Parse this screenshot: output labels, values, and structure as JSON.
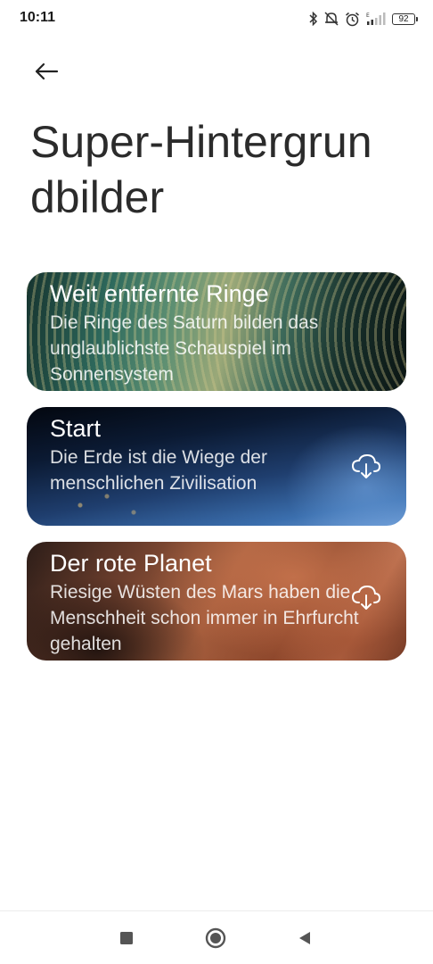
{
  "status_bar": {
    "time": "10:11",
    "battery_level": "92",
    "icons": [
      "bluetooth-icon",
      "alarm-off-icon",
      "alarm-clock-icon",
      "signal-icon",
      "battery-icon"
    ]
  },
  "header": {
    "back_icon": "arrow-left-icon",
    "title": "Super-Hintergrundbilder"
  },
  "cards": [
    {
      "title": "Weit entfernte Ringe",
      "description": "Die Ringe des Saturn bilden das unglaublichste Schauspiel im Sonnensystem",
      "downloadable": false
    },
    {
      "title": "Start",
      "description": "Die Erde ist die Wiege der menschlichen Zivilisation",
      "downloadable": true,
      "icon": "cloud-download-icon"
    },
    {
      "title": "Der rote Planet",
      "description": "Riesige Wüsten des Mars haben die Menschheit schon immer in Ehrfurcht gehalten",
      "downloadable": true,
      "icon": "cloud-download-icon"
    }
  ],
  "nav_bar": {
    "items": [
      "recents-square-icon",
      "home-circle-icon",
      "back-triangle-icon"
    ]
  }
}
